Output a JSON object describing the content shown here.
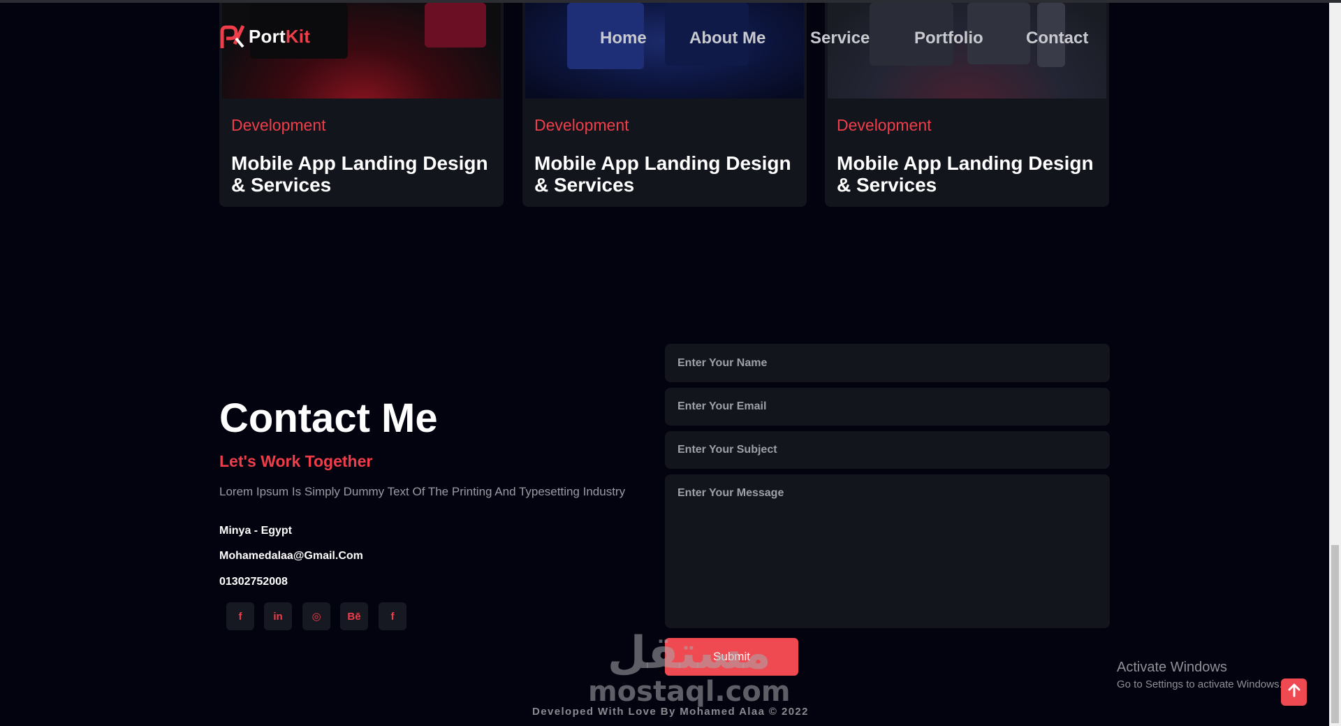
{
  "header": {
    "logo_text_part1": "Port",
    "logo_text_part2": "Kit",
    "nav": [
      "Home",
      "About Me",
      "Service",
      "Portfolio",
      "Contact"
    ]
  },
  "portfolio": {
    "cards": [
      {
        "category": "Development",
        "title": "Mobile App Landing Design & Services"
      },
      {
        "category": "Development",
        "title": "Mobile App Landing Design & Services"
      },
      {
        "category": "Development",
        "title": "Mobile App Landing Design & Services"
      }
    ]
  },
  "contact": {
    "title": "Contact Me",
    "subtitle": "Let's Work Together",
    "description": "Lorem Ipsum Is Simply Dummy Text Of The Printing And Typesetting Industry",
    "location": "Minya - Egypt",
    "email": "Mohamedalaa@Gmail.Com",
    "phone": "01302752008",
    "social": [
      {
        "icon": "facebook-icon",
        "glyph": "f"
      },
      {
        "icon": "linkedin-icon",
        "glyph": "in"
      },
      {
        "icon": "instagram-icon",
        "glyph": "◎"
      },
      {
        "icon": "behance-icon",
        "glyph": "Bē"
      },
      {
        "icon": "facebook-icon",
        "glyph": "f"
      }
    ]
  },
  "form": {
    "name_placeholder": "Enter Your Name",
    "email_placeholder": "Enter Your Email",
    "subject_placeholder": "Enter Your Subject",
    "message_placeholder": "Enter Your Message",
    "submit_label": "Submit"
  },
  "footer": {
    "text": "Developed With Love By Mohamed Alaa © 2022"
  },
  "watermark": {
    "arabic": "مستقل",
    "latin": "mostaql.com"
  },
  "windows_notice": {
    "title": "Activate Windows",
    "subtitle": "Go to Settings to activate Windows."
  },
  "colors": {
    "accent": "#ef3e4a",
    "background": "#02030f",
    "card": "#12151c"
  }
}
